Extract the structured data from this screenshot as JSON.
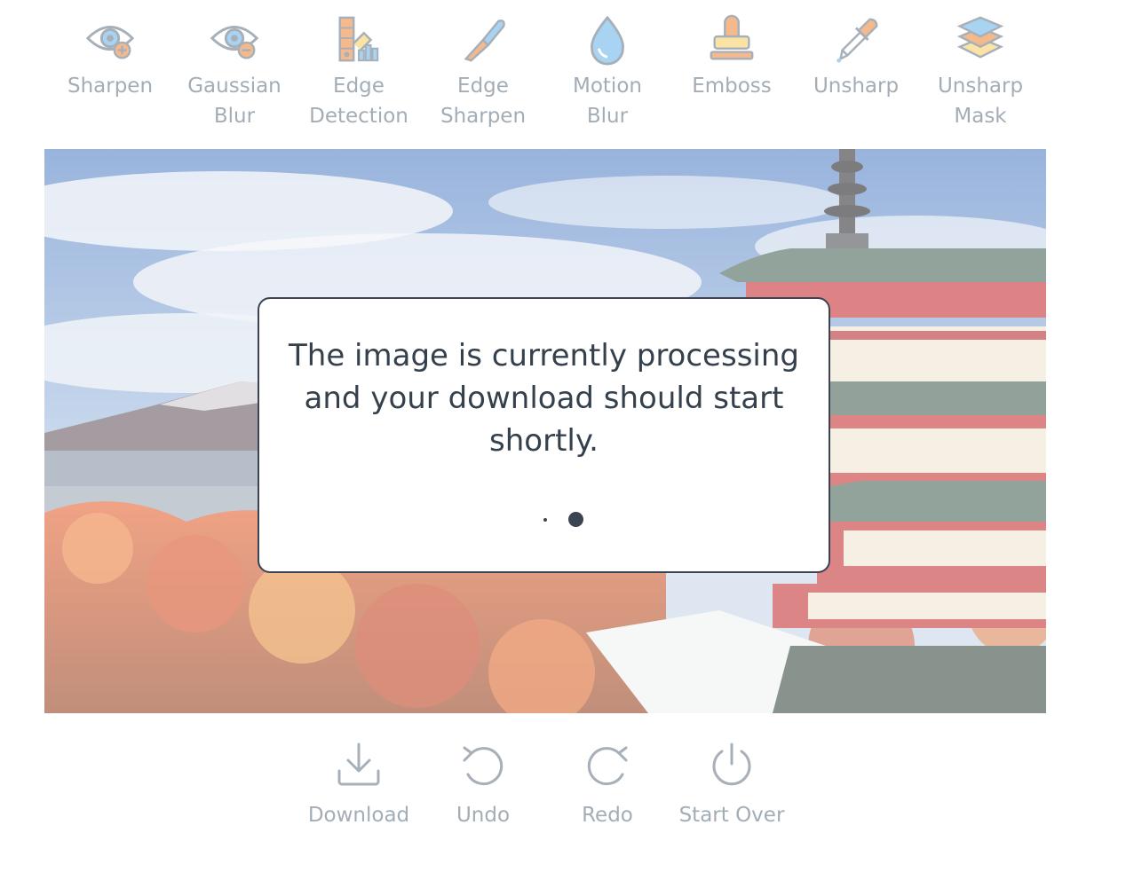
{
  "toolbar": {
    "filters": [
      {
        "label": "Sharpen",
        "icon": "eye-plus-icon"
      },
      {
        "label": "Gaussian\nBlur",
        "icon": "eye-minus-icon"
      },
      {
        "label": "Edge\nDetection",
        "icon": "palette-chart-icon"
      },
      {
        "label": "Edge\nSharpen",
        "icon": "scalpel-icon"
      },
      {
        "label": "Motion\nBlur",
        "icon": "drop-icon"
      },
      {
        "label": "Emboss",
        "icon": "stamp-icon"
      },
      {
        "label": "Unsharp",
        "icon": "dropper-icon"
      },
      {
        "label": "Unsharp\nMask",
        "icon": "layers-icon"
      }
    ]
  },
  "modal": {
    "message": "The image is currently processing and your download should start shortly."
  },
  "actions": [
    {
      "label": "Download",
      "icon": "download-icon"
    },
    {
      "label": "Undo",
      "icon": "undo-icon"
    },
    {
      "label": "Redo",
      "icon": "redo-icon"
    },
    {
      "label": "Start Over",
      "icon": "power-icon"
    }
  ],
  "colors": {
    "icon_outline": "#a7b0b9",
    "icon_accent_orange": "#f4b98c",
    "icon_accent_blue": "#a9d3f2",
    "icon_accent_yellow": "#fbe3a6",
    "label_text": "#a3adb6",
    "modal_text": "#35404d",
    "modal_border": "#3a4452"
  }
}
